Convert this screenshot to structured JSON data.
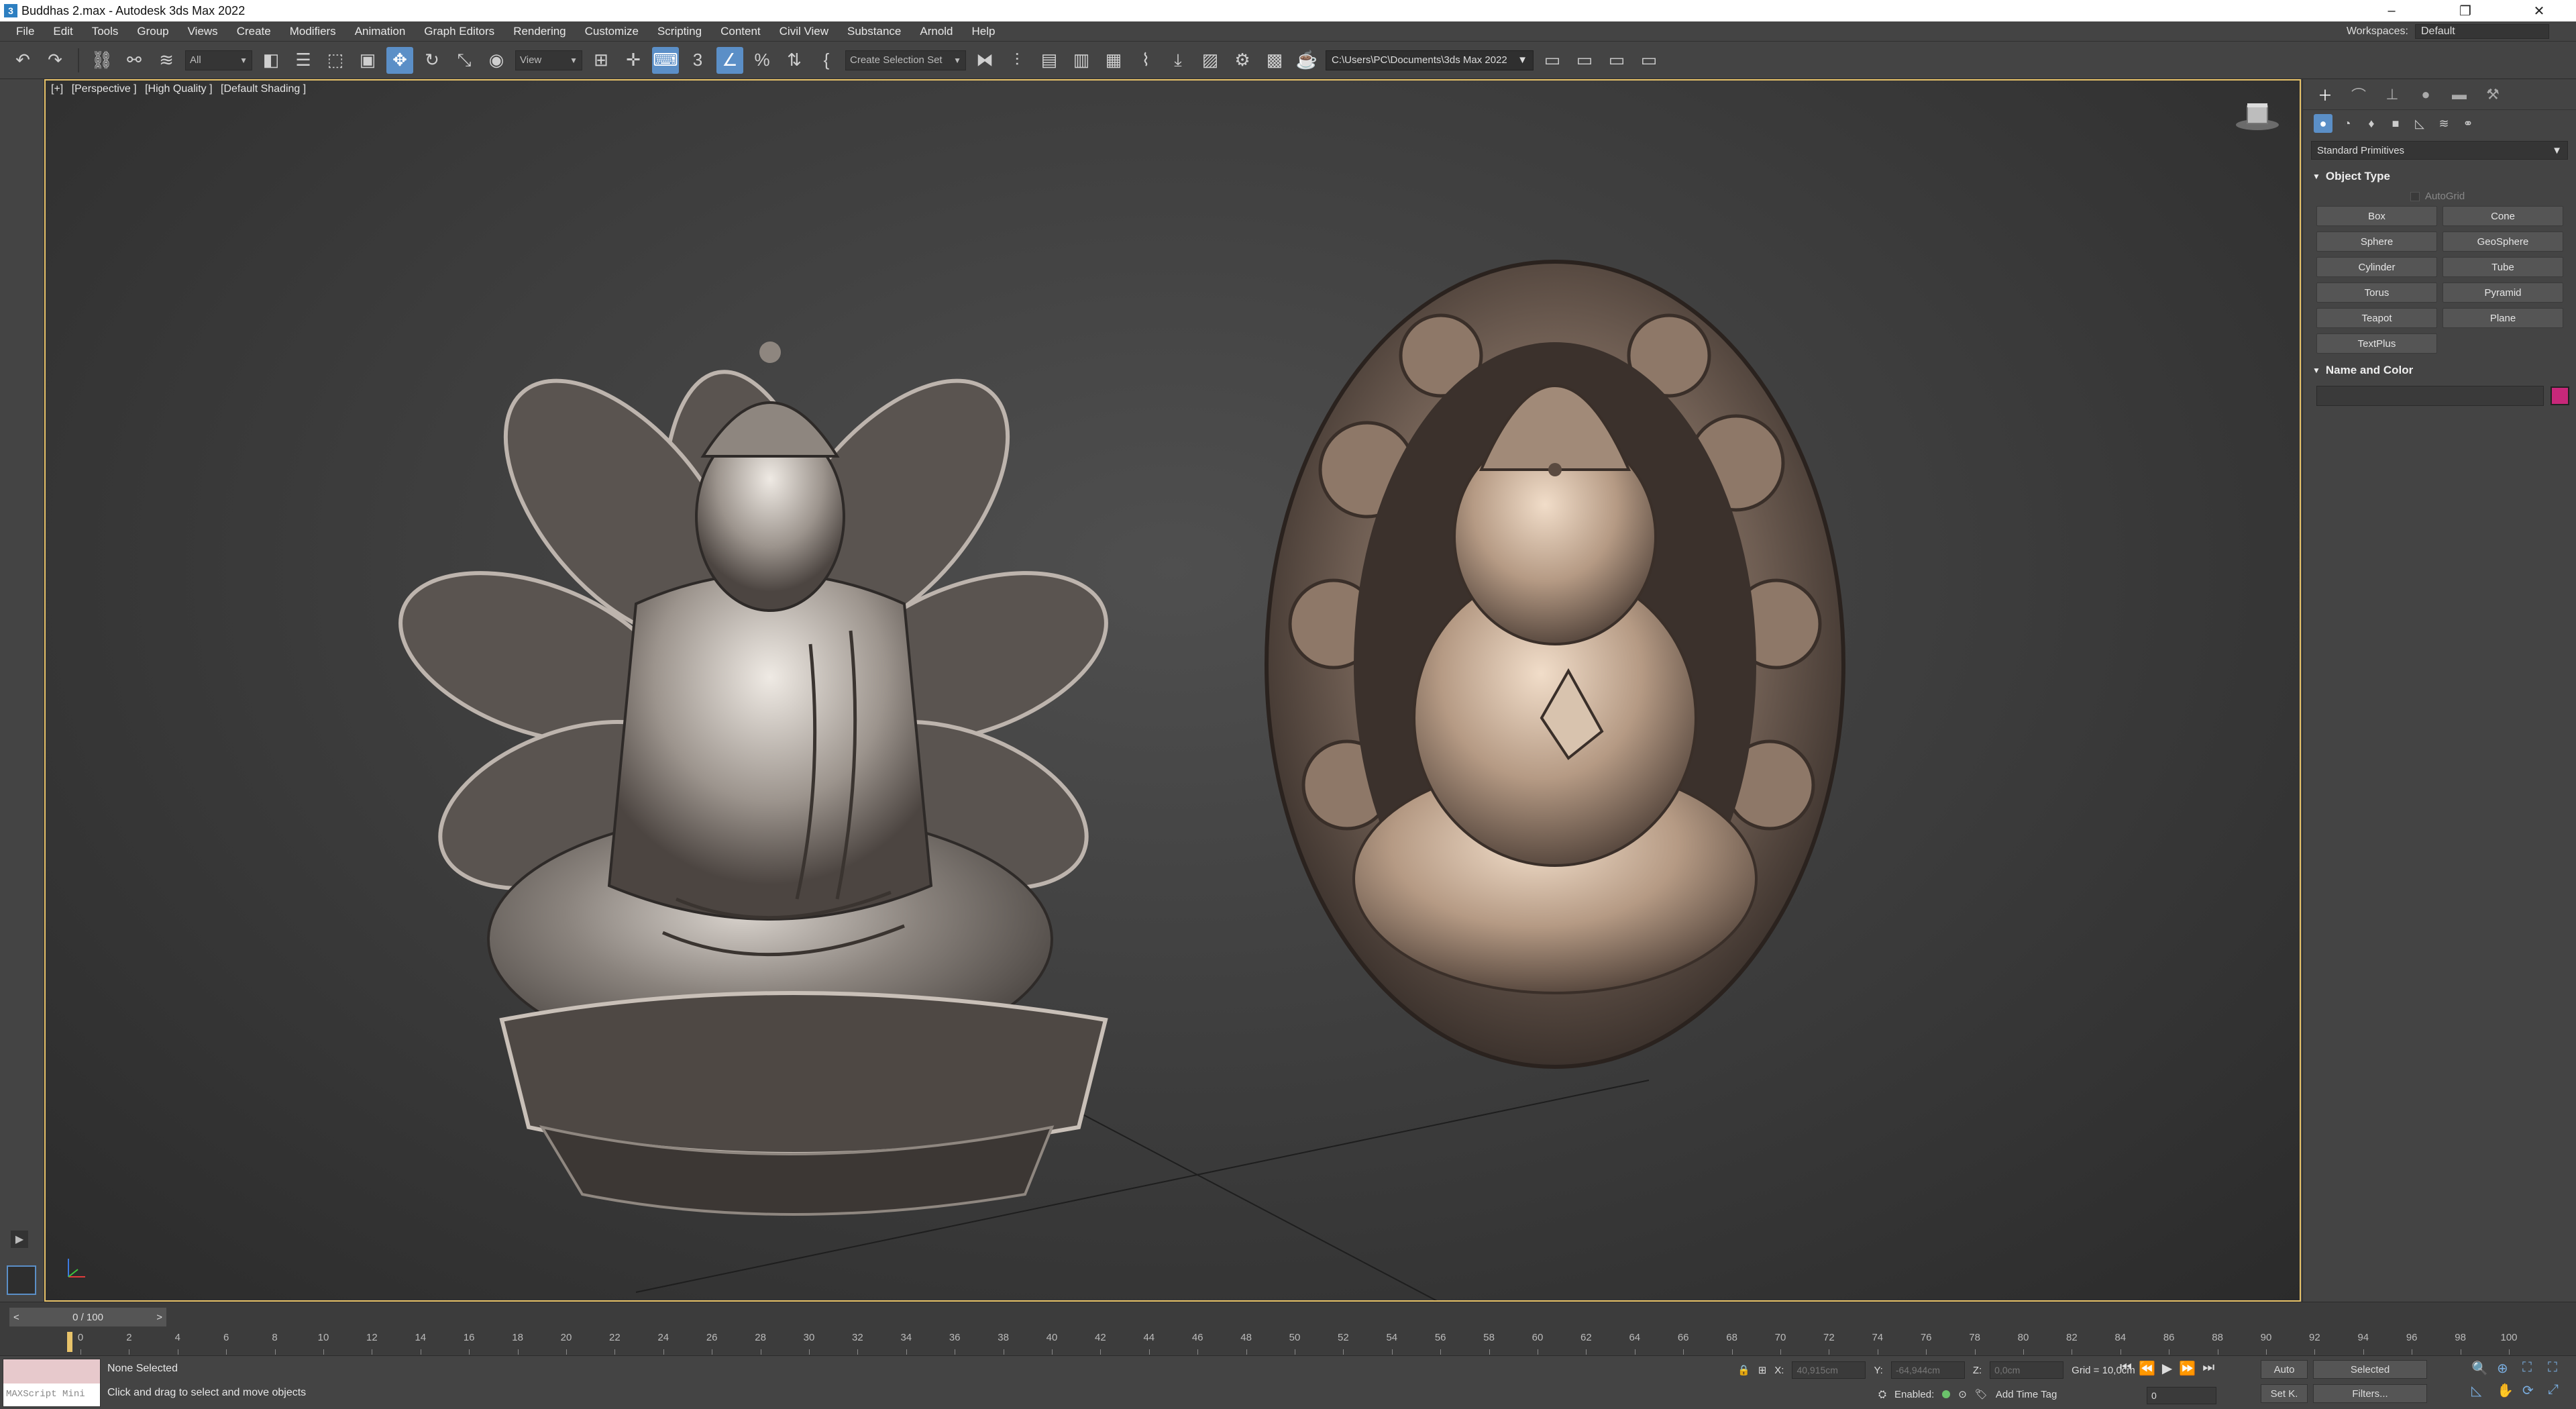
{
  "window": {
    "title": "Buddhas 2.max - Autodesk 3ds Max 2022",
    "app_icon": "3",
    "controls": [
      "–",
      "❐",
      "✕"
    ]
  },
  "menu": [
    "File",
    "Edit",
    "Tools",
    "Group",
    "Views",
    "Create",
    "Modifiers",
    "Animation",
    "Graph Editors",
    "Rendering",
    "Customize",
    "Scripting",
    "Content",
    "Civil View",
    "Substance",
    "Arnold",
    "Help"
  ],
  "workspaces": {
    "label": "Workspaces:",
    "value": "Default"
  },
  "toolbar": {
    "selection_filter": "All",
    "ref_coord": "View",
    "selection_set": "Create Selection Set",
    "project_path": "C:\\Users\\PC\\Documents\\3ds Max 2022"
  },
  "viewport": {
    "labels": [
      "[+]",
      "[Perspective ]",
      "[High Quality ]",
      "[Default Shading ]"
    ]
  },
  "command_panel": {
    "category": "Standard Primitives",
    "object_type_title": "Object Type",
    "autogrid_label": "AutoGrid",
    "buttons": [
      "Box",
      "Cone",
      "Sphere",
      "GeoSphere",
      "Cylinder",
      "Tube",
      "Torus",
      "Pyramid",
      "Teapot",
      "Plane",
      "TextPlus"
    ],
    "name_color_title": "Name and Color",
    "swatch_color": "#c8287a"
  },
  "timeline": {
    "frame_readout": "0 / 100",
    "prev": "<",
    "next": ">",
    "ticks": [
      "0",
      "2",
      "4",
      "6",
      "8",
      "10",
      "12",
      "14",
      "16",
      "18",
      "20",
      "22",
      "24",
      "26",
      "28",
      "30",
      "32",
      "34",
      "36",
      "38",
      "40",
      "42",
      "44",
      "46",
      "48",
      "50",
      "52",
      "54",
      "56",
      "58",
      "60",
      "62",
      "64",
      "66",
      "68",
      "70",
      "72",
      "74",
      "76",
      "78",
      "80",
      "82",
      "84",
      "86",
      "88",
      "90",
      "92",
      "94",
      "96",
      "98",
      "100"
    ]
  },
  "status": {
    "maxscript_label": "MAXScript Mini",
    "selection": "None Selected",
    "prompt": "Click and drag to select and move objects",
    "x_label": "X:",
    "x_value": "40,915cm",
    "y_label": "Y:",
    "y_value": "-64,944cm",
    "z_label": "Z:",
    "z_value": "0,0cm",
    "grid": "Grid = 10,0cm",
    "enabled_label": "Enabled:",
    "add_time_tag": "Add Time Tag",
    "current_frame": "0",
    "auto_label": "Auto",
    "selected_value": "Selected",
    "setk_label": "Set K.",
    "filters_label": "Filters..."
  },
  "colors": {
    "accent": "#5b8fc7",
    "viewport_border": "#e8c36a"
  }
}
